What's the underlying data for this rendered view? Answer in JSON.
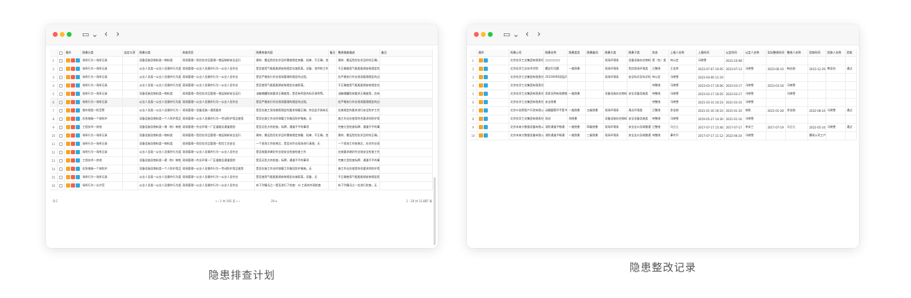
{
  "colors": {
    "close": "#fe5f57",
    "minimize": "#febc2e",
    "zoom": "#28c840",
    "edit": "#f5a623",
    "delete": "#f0624d",
    "view": "#2fa9e0"
  },
  "icons": {
    "sidebar": "sidebar-toggle-icon",
    "back": "chevron-left-icon",
    "forward": "chevron-right-icon"
  },
  "left": {
    "caption": "隐患排查计划",
    "columns": [
      "",
      "",
      "操作",
      "隐患分类",
      "自定义项",
      "隐患分类",
      "排查项目",
      "隐患排查内容",
      "备注",
      "整改措施描述",
      "备注"
    ],
    "rows": [
      [
        "1",
        "场所行为一场所记录",
        "设备设施及物料类一物料类",
        "现场管理一危险化学品管理一储运装卸安全运行",
        "建材、搬运危险化学品时需按规定穿戴、轻拿、不正确、违、无",
        "建材、搬运危险化学品时的正确，无"
      ],
      [
        "2",
        "场所行为一场所记录",
        "从业人员类一从业人员操作行为类",
        "现场管理一从业人员操作行为一从业人员作业",
        "是否使用气瓶瓶瓶柄安装规定存放距离，设备、地坪和工作台、无",
        "不正确使用气瓶瓶瓶柄安装规定的距离，无"
      ],
      [
        "3",
        "场所行为一场所记录",
        "从业人员类一从业人员操作行为类",
        "现场管理一从业人员操作行为一从业人员作业",
        "是否严格执行作业现场管理的规定的过程。",
        "应严格执行作业现场管理规定的过程，无"
      ],
      [
        "4",
        "场所行为一场所记录",
        "从业人员类一从业人员操作行为类",
        "现场管理一从业人员操作行为一从业人员作业",
        "是否使用气瓶瓶瓶柄安装规定存放距离。",
        "不正确使用气瓶瓶瓶柄安装规定存放距离"
      ],
      [
        "5",
        "场所行为一场所记录",
        "设备设施及物料类一物料类",
        "现场管理一危险化学品管理一储运装卸安全运行",
        "油箱储罐包装要求正确使用，是否有明显的标识说明等。",
        "油箱储罐包装要求正确使用，应有标识说明"
      ],
      [
        "6",
        "场所行为一场所记录",
        "从业人员类一从业人员操作行为类",
        "现场管理一从业人员操作行为一从业人员作业",
        "是否严格执行作业现场管理的规定的过程。",
        "应严格执行作业现场管理规定的过程，无"
      ],
      [
        "7",
        "操作规程一防范警",
        "从业人员类一从业人员操作行为一工艺安全",
        "现场管理一设备设施一通用要求",
        "是否在施工现场按照规定的要求穿戴正确，你见此不具体无",
        "应按规定的要求进行安全防护工作"
      ],
      [
        "8",
        "应急措施一个体防护",
        "设备设施及物料类一个人防护用品",
        "现场管理一从业人员操作行为一劳动防护用品使用",
        "是否在施工作业时穿戴工作服及防护措施，无",
        "施工作业应使用符合要求的防护用品，无"
      ],
      [
        "9",
        "工程技术一其他",
        "设备设施及物料类一建（构）筑物类",
        "现场管理一作业环境一厂区道路及通道规划",
        "是否无危大的检查，标牌、通道不平的事项",
        "完善大型检查标牌、通道不平的事项"
      ],
      [
        "10",
        "场所行为一场所记录",
        "设备设施及物料类一物料类",
        "现场管理一危险化学品管理一储运装卸安全运行",
        "建材、搬运危险化学品时需按规定穿戴、轻拿、不正确、违、无",
        "建材、搬运危险化学品时的正确，无"
      ],
      [
        "11",
        "场所行为一场所记录",
        "设备设施及物料类一物料类",
        "现场管理一危险化学品管理一危险工艺安全",
        "一个现场工作结束后，是否对作业现场进行清理，无",
        "一个现场工作结束后，应对作业现场清理"
      ],
      [
        "12",
        "场所行为一场所记录",
        "从业人员类一从业人员操作行为类",
        "现场管理一从业人员操作行为一从业人员作业",
        "是否按要求做好作业前安全检查检查工作",
        "应按要求做好作业前安全检查工作"
      ],
      [
        "13",
        "工程技术一其他",
        "设备设施及物料类一建（构）筑物类",
        "现场管理一作业环境一厂区道路及通道规划",
        "是否无危大的检查，标牌、通道不平的事项",
        "完善大型检查标牌、通道不平的事项"
      ],
      [
        "14",
        "应急措施一个体防护",
        "设备设施及物料类一个人防护用品",
        "现场管理一从业人员操作行为一劳动防护用品使用",
        "是否在施工作业时穿戴工作服及防护措施，无",
        "施工作业应使用符合要求的防护用品，无"
      ],
      [
        "15",
        "场所行为一场所记录",
        "从业人员类一从业人员操作行为类",
        "现场管理一从业人员操作行为一从业人员作业",
        "是否使用气瓶瓶瓶柄安装规定存放距离，设备、无",
        "不正确使用气瓶瓶瓶柄安装规定距离，无"
      ],
      [
        "16",
        "场所行为一允许范",
        "从业人员类一从业人员操作行为类",
        "现场管理一从业人员操作行为一从业人员作业",
        "有下列情况之一是否进行了检查：a) 工具的外观检查",
        "有下列情况之一应进行检查，无"
      ]
    ],
    "pager": {
      "left_icons": "Q  C",
      "nav": "«  ‹   1   共 165 页   »  ›",
      "size": "20 ▾",
      "summary": "1 - 20  共 11,887 条"
    }
  },
  "right": {
    "caption": "隐患整改记录",
    "columns": [
      "",
      "操作",
      "所属公司",
      "隐患名称",
      "隐患类型",
      "隐患级别",
      "隐患大类",
      "隐患子类",
      "状态",
      "上报人名称",
      "上报时间",
      "认定时间",
      "认定人名称",
      "实际整改时间",
      "整改人名称",
      "验收时间",
      "验收人名称",
      "验收"
    ],
    "rows": [
      [
        "1",
        "北京化学工业集团有限责任公司",
        "??????????",
        "",
        "",
        "现场环境条",
        "设备设施存在物料管理",
        "是（包）类",
        "待认定",
        "马晓雪",
        "2023-10-08 16:25:47",
        "",
        "",
        "",
        "",
        "",
        "",
        ""
      ],
      [
        "2",
        "北京化学工业技术学院",
        "螺丝钉问题",
        "一般隐患",
        "",
        "现场环境条",
        "危险现场环境类",
        "已整改",
        "王金库",
        "2023-07-07 10:05:23",
        "2023-07-13",
        "马晓雪",
        "2023-06-10",
        "韩志刚",
        "2023-12-29",
        "熊金柱",
        "通过"
      ],
      [
        "3",
        "北京化学工业集团有限责任公司",
        "20230406双层问题",
        "",
        "",
        "现场环境条",
        "安全标识及标识标志",
        "待认定",
        "马晓雪",
        "2023-04-06 11:19:46",
        "",
        "",
        "",
        "",
        "",
        "",
        ""
      ],
      [
        "4",
        "北京化学工业集团有限责任公司",
        "",
        "",
        "",
        "",
        "",
        "待整改",
        "马晓雪",
        "2023-03-17 16:06:28",
        "2023-03-17",
        "马晓雪",
        "2023-03-18",
        "马晓雪",
        "",
        "",
        ""
      ],
      [
        "5",
        "北京化学工业集团有限责任公司",
        "资质证明有效期限",
        "一般隐患",
        "",
        "设备设施存在物料管理",
        "安全设备设施类",
        "待整改",
        "马晓雪",
        "2023-03-17 16:05:41",
        "2023-03-17",
        "马晓雪",
        "",
        "马晓雪",
        "",
        "",
        ""
      ],
      [
        "6",
        "北京化学工业集团有限责任公司",
        "安全隐患",
        "",
        "",
        "",
        "",
        "待整改",
        "马晓雪",
        "2021-03-10 10:23:51",
        "2021-03-10",
        "马晓雪",
        "",
        "",
        "",
        "",
        ""
      ],
      [
        "7",
        "北京众创奇智产开发有限公司",
        "动圈圆筒环手套书",
        "一般隐患",
        "五级隐患",
        "现场环境条",
        "周边环境类",
        "已整改",
        "多金刚",
        "2021-01-30 16:10:30",
        "2021-01-24",
        "胡帆",
        "2021-01-28",
        "多金刚",
        "2022-08-24",
        "马晓雪",
        "通过"
      ],
      [
        "8",
        "北京化学工业集团有限责任公司",
        "测试",
        "你隐患",
        "",
        "设备设施存在物料管理",
        "安全设备设施类",
        "待整改",
        "马晓雪",
        "2019-05-27 14:30:35",
        "2021-01-16",
        "马晓雪",
        "",
        "",
        "",
        "",
        ""
      ],
      [
        "9",
        "北京未来大数据设备有限公司",
        "消防通道不畅通",
        "一般隐患",
        "四级隐患",
        "现场环境条",
        "安全出口及疏散通道",
        "已整改",
        "马立江",
        "2017-07-17 15:40:01",
        "2017-07-17",
        "李永兰",
        "2017-07-19",
        "马立江",
        "2022-05-24",
        "马晓雪",
        "通过"
      ],
      [
        "10",
        "北京未来大数据设备有限公司",
        "消防通道不畅通",
        "一般隐患",
        "三级隐患",
        "现场环境条",
        "安全出口及疏散通道",
        "待整改",
        "事件开",
        "2017-07-17 11:12:03",
        "2022-06-24",
        "马晓雪",
        "",
        "",
        "暴雨公司工产安全",
        "",
        ""
      ]
    ]
  }
}
